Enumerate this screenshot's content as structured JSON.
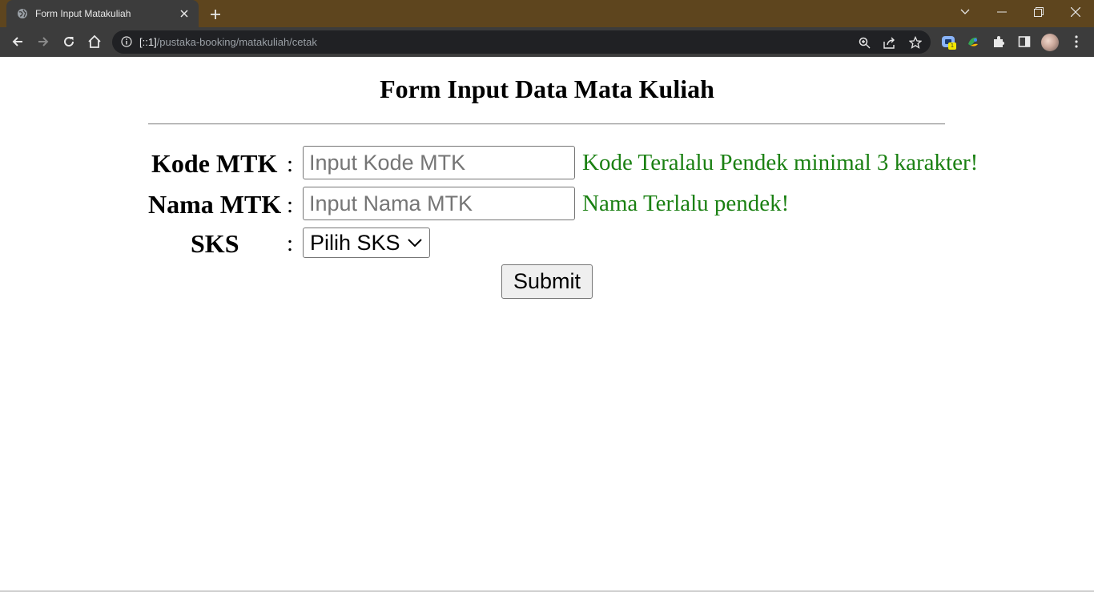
{
  "browser": {
    "tab_title": "Form Input Matakuliah",
    "url_host": "[::1]",
    "url_path": "/pustaka-booking/matakuliah/cetak",
    "extension_badge": "1",
    "colors": {
      "titlebar": "#5e451e",
      "toolbar": "#3c3c3c",
      "omnibox": "#202124"
    }
  },
  "page": {
    "title": "Form Input Data Mata Kuliah",
    "fields": {
      "kode": {
        "label": "Kode MTK",
        "colon": ":",
        "value": "",
        "placeholder": "Input Kode MTK",
        "error": "Kode Teralalu Pendek minimal 3 karakter!"
      },
      "nama": {
        "label": "Nama MTK",
        "colon": ":",
        "value": "",
        "placeholder": "Input Nama MTK",
        "error": "Nama Terlalu pendek!"
      },
      "sks": {
        "label": "SKS",
        "colon": ":",
        "selected": "Pilih SKS"
      }
    },
    "submit_label": "Submit",
    "colors": {
      "error_text": "#1a8012"
    }
  }
}
